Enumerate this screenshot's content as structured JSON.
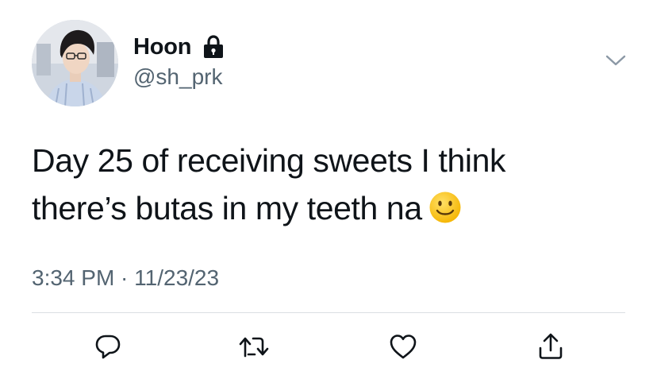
{
  "author": {
    "display_name": "Hoon",
    "handle": "@sh_prk",
    "protected_icon": "lock-icon",
    "avatar": "profile-photo"
  },
  "tweet": {
    "text_line1": "Day 25 of receiving sweets I think",
    "text_line2": "there’s butas in my teeth na",
    "emoji": "slightly-smiling-face",
    "timestamp": "3:34 PM · 11/23/23"
  },
  "actions": [
    {
      "name": "reply",
      "icon": "comment-icon"
    },
    {
      "name": "retweet",
      "icon": "retweet-icon"
    },
    {
      "name": "like",
      "icon": "heart-icon"
    },
    {
      "name": "share",
      "icon": "share-icon"
    }
  ],
  "colors": {
    "text": "#0f1419",
    "secondary": "#536471",
    "divider": "#dadfe3",
    "emoji_face": "#ffcc33"
  }
}
